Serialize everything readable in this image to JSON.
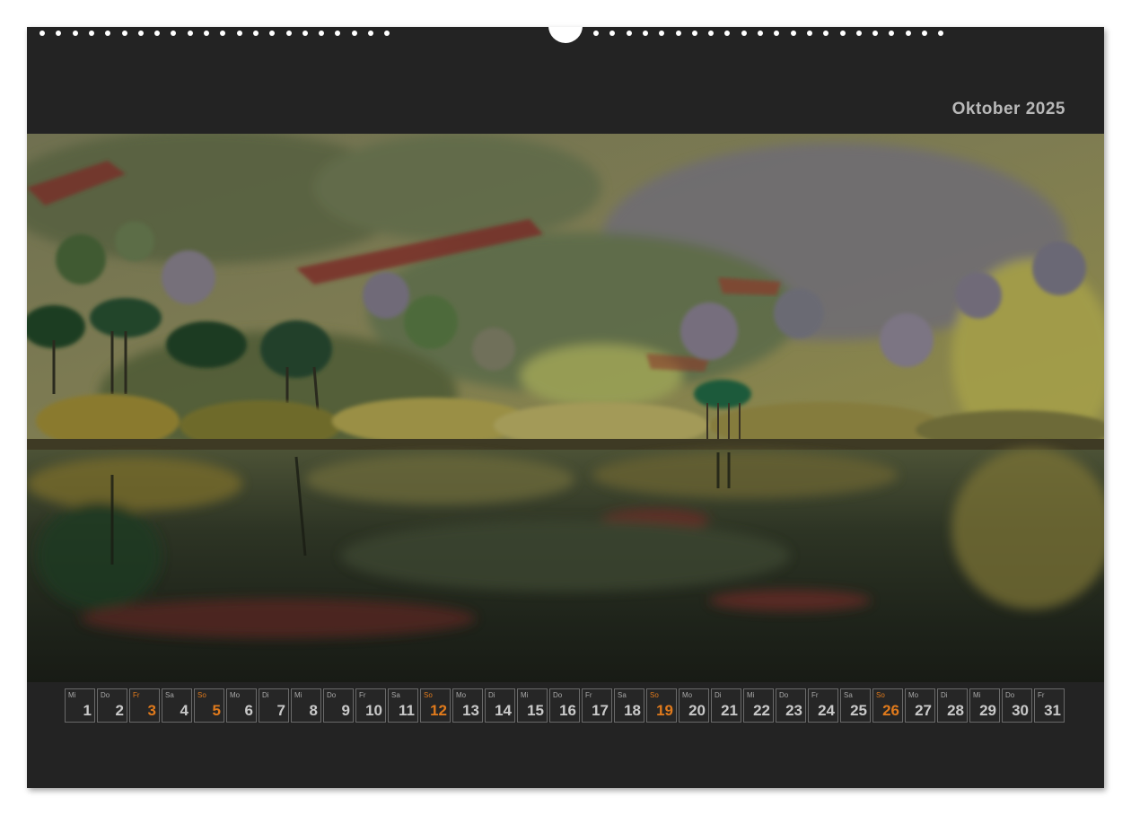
{
  "calendar": {
    "month_title": "Oktober 2025",
    "colors": {
      "background": "#232323",
      "day_text": "#c9c9c9",
      "highlight": "#e07a1c"
    },
    "photo_icon": "landscape-photo-loch-reflection",
    "days": [
      {
        "wd": "Mi",
        "num": "1",
        "holiday": false
      },
      {
        "wd": "Do",
        "num": "2",
        "holiday": false
      },
      {
        "wd": "Fr",
        "num": "3",
        "holiday": true
      },
      {
        "wd": "Sa",
        "num": "4",
        "holiday": false
      },
      {
        "wd": "So",
        "num": "5",
        "holiday": true
      },
      {
        "wd": "Mo",
        "num": "6",
        "holiday": false
      },
      {
        "wd": "Di",
        "num": "7",
        "holiday": false
      },
      {
        "wd": "Mi",
        "num": "8",
        "holiday": false
      },
      {
        "wd": "Do",
        "num": "9",
        "holiday": false
      },
      {
        "wd": "Fr",
        "num": "10",
        "holiday": false
      },
      {
        "wd": "Sa",
        "num": "11",
        "holiday": false
      },
      {
        "wd": "So",
        "num": "12",
        "holiday": true
      },
      {
        "wd": "Mo",
        "num": "13",
        "holiday": false
      },
      {
        "wd": "Di",
        "num": "14",
        "holiday": false
      },
      {
        "wd": "Mi",
        "num": "15",
        "holiday": false
      },
      {
        "wd": "Do",
        "num": "16",
        "holiday": false
      },
      {
        "wd": "Fr",
        "num": "17",
        "holiday": false
      },
      {
        "wd": "Sa",
        "num": "18",
        "holiday": false
      },
      {
        "wd": "So",
        "num": "19",
        "holiday": true
      },
      {
        "wd": "Mo",
        "num": "20",
        "holiday": false
      },
      {
        "wd": "Di",
        "num": "21",
        "holiday": false
      },
      {
        "wd": "Mi",
        "num": "22",
        "holiday": false
      },
      {
        "wd": "Do",
        "num": "23",
        "holiday": false
      },
      {
        "wd": "Fr",
        "num": "24",
        "holiday": false
      },
      {
        "wd": "Sa",
        "num": "25",
        "holiday": false
      },
      {
        "wd": "So",
        "num": "26",
        "holiday": true
      },
      {
        "wd": "Mo",
        "num": "27",
        "holiday": false
      },
      {
        "wd": "Di",
        "num": "28",
        "holiday": false
      },
      {
        "wd": "Mi",
        "num": "29",
        "holiday": false
      },
      {
        "wd": "Do",
        "num": "30",
        "holiday": false
      },
      {
        "wd": "Fr",
        "num": "31",
        "holiday": false
      }
    ]
  }
}
